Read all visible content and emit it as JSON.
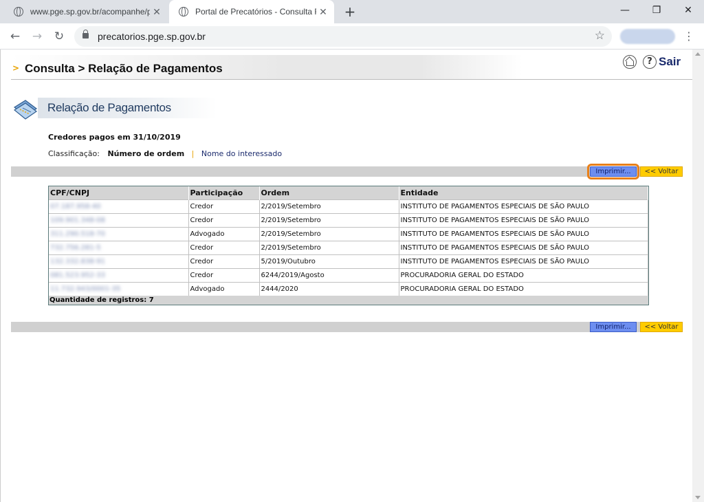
{
  "browser": {
    "tabs": [
      {
        "title": "www.pge.sp.gov.br/acompanhe/p",
        "active": false
      },
      {
        "title": "Portal de Precatórios - Consulta F",
        "active": true
      }
    ],
    "url": "precatorios.pge.sp.gov.br",
    "controls": {
      "minimize": "—",
      "restore": "❐",
      "close": "✕",
      "new_tab": "+",
      "tab_close": "✕",
      "back": "←",
      "forward": "→",
      "reload": "↻",
      "star": "☆",
      "menu": "⋮"
    }
  },
  "header": {
    "title": "Consulta > Relação de Pagamentos",
    "help": "?",
    "logout": "Sair"
  },
  "section": {
    "title": "Relação de Pagamentos"
  },
  "summary": {
    "credores": "Credores pagos em 31/10/2019",
    "classificacao_label": "Classificação:",
    "selected": "Número de ordem",
    "separator": "|",
    "alternative": "Nome do interessado"
  },
  "actions": {
    "print": "Imprimir...",
    "back": "<< Voltar"
  },
  "table": {
    "columns": [
      "CPF/CNPJ",
      "Participação",
      "Ordem",
      "Entidade"
    ],
    "rows": [
      [
        "07.187.958-40",
        "Credor",
        "2/2019/Setembro",
        "INSTITUTO DE PAGAMENTOS ESPECIAIS DE SÃO PAULO"
      ],
      [
        "109.901.348-08",
        "Credor",
        "2/2019/Setembro",
        "INSTITUTO DE PAGAMENTOS ESPECIAIS DE SÃO PAULO"
      ],
      [
        "311.290.518-70",
        "Advogado",
        "2/2019/Setembro",
        "INSTITUTO DE PAGAMENTOS ESPECIAIS DE SÃO PAULO"
      ],
      [
        "732.756.281-5",
        "Credor",
        "2/2019/Setembro",
        "INSTITUTO DE PAGAMENTOS ESPECIAIS DE SÃO PAULO"
      ],
      [
        "132.332.838-91",
        "Credor",
        "5/2019/Outubro",
        "INSTITUTO DE PAGAMENTOS ESPECIAIS DE SÃO PAULO"
      ],
      [
        "081.523.952-33",
        "Credor",
        "6244/2019/Agosto",
        "PROCURADORIA GERAL DO ESTADO"
      ],
      [
        "11.732.943/0001-35",
        "Advogado",
        "2444/2020",
        "PROCURADORIA GERAL DO ESTADO"
      ]
    ],
    "total": "Quantidade de registros: 7"
  },
  "colors": {
    "accent": "#e8a200",
    "print_button": "#6d8ef0",
    "back_button": "#ffcc00",
    "focus_ring": "#e8801a"
  }
}
